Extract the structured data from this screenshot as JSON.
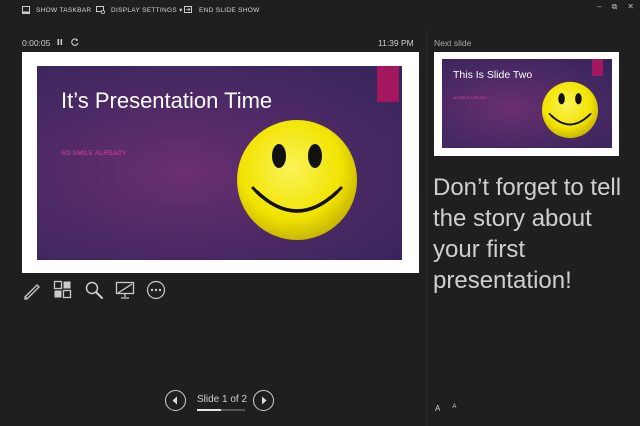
{
  "toolbar": {
    "show_taskbar": "SHOW TASKBAR",
    "display_settings": "DISPLAY SETTINGS ▾",
    "end_slide_show": "END SLIDE SHOW"
  },
  "window_controls": {
    "minimize": "–",
    "restore": "⧉",
    "close": "✕"
  },
  "presenter": {
    "timer": "0:00:05",
    "clock": "11:39 PM",
    "next_slide_label": "Next slide"
  },
  "current_slide": {
    "title": "It’s Presentation Time",
    "subtitle": "SO SMILE ALREADY"
  },
  "next_slide": {
    "title": "This Is Slide Two",
    "subtitle": "SO SMILE ALREADY"
  },
  "notes": {
    "text": "Don’t forget to tell the story about your first presentation!"
  },
  "navigation": {
    "label": "Slide 1 of 2",
    "progress": 0.5
  },
  "font_controls": {
    "increase": "A",
    "decrease": "A"
  },
  "colors": {
    "background": "#1f1f1f",
    "accent_tab": "#a2175e",
    "subtitle_pink": "#e0439a",
    "smiley_yellow": "#f3ea00"
  },
  "icons": [
    "taskbar-icon",
    "display-settings-icon",
    "end-show-icon",
    "pause-icon",
    "restart-icon",
    "pen-icon",
    "see-all-slides-icon",
    "zoom-icon",
    "black-screen-icon",
    "more-options-icon",
    "previous-icon",
    "next-icon"
  ]
}
